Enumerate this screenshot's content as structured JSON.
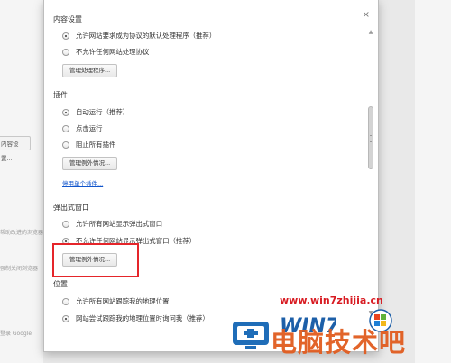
{
  "background": {
    "button_label": "内容设置...",
    "hints": [
      "帮助改进的浏览器",
      "强制关闭浏览器",
      "登录 Google"
    ]
  },
  "dialog": {
    "close_label": "×",
    "sections": {
      "handlers": {
        "title": "内容设置",
        "options": [
          "允许网站要求成为协议的默认处理程序（推荐）",
          "不允许任何网站处理协议"
        ],
        "button": "管理处理程序..."
      },
      "plugins": {
        "title": "插件",
        "options": [
          "自动运行（推荐）",
          "点击运行",
          "阻止所有插件"
        ],
        "button": "管理例外情况...",
        "link": "停用单个插件..."
      },
      "popups": {
        "title": "弹出式窗口",
        "options": [
          "允许所有网站显示弹出式窗口",
          "不允许任何网站显示弹出式窗口（推荐）"
        ],
        "button": "管理例外情况..."
      },
      "location": {
        "title": "位置",
        "options": [
          "允许所有网站跟踪我的地理位置",
          "网站尝试跟踪我的地理位置时询问我（推荐）"
        ]
      }
    }
  },
  "watermark": {
    "url": "www.win7zhijia.cn",
    "logo": "WIN7",
    "brand": "电脑技术吧"
  },
  "colors": {
    "highlight": "#e5252a",
    "link": "#1155cc",
    "watermark_url": "#d81b22",
    "watermark_brand": "#e15c1f"
  }
}
